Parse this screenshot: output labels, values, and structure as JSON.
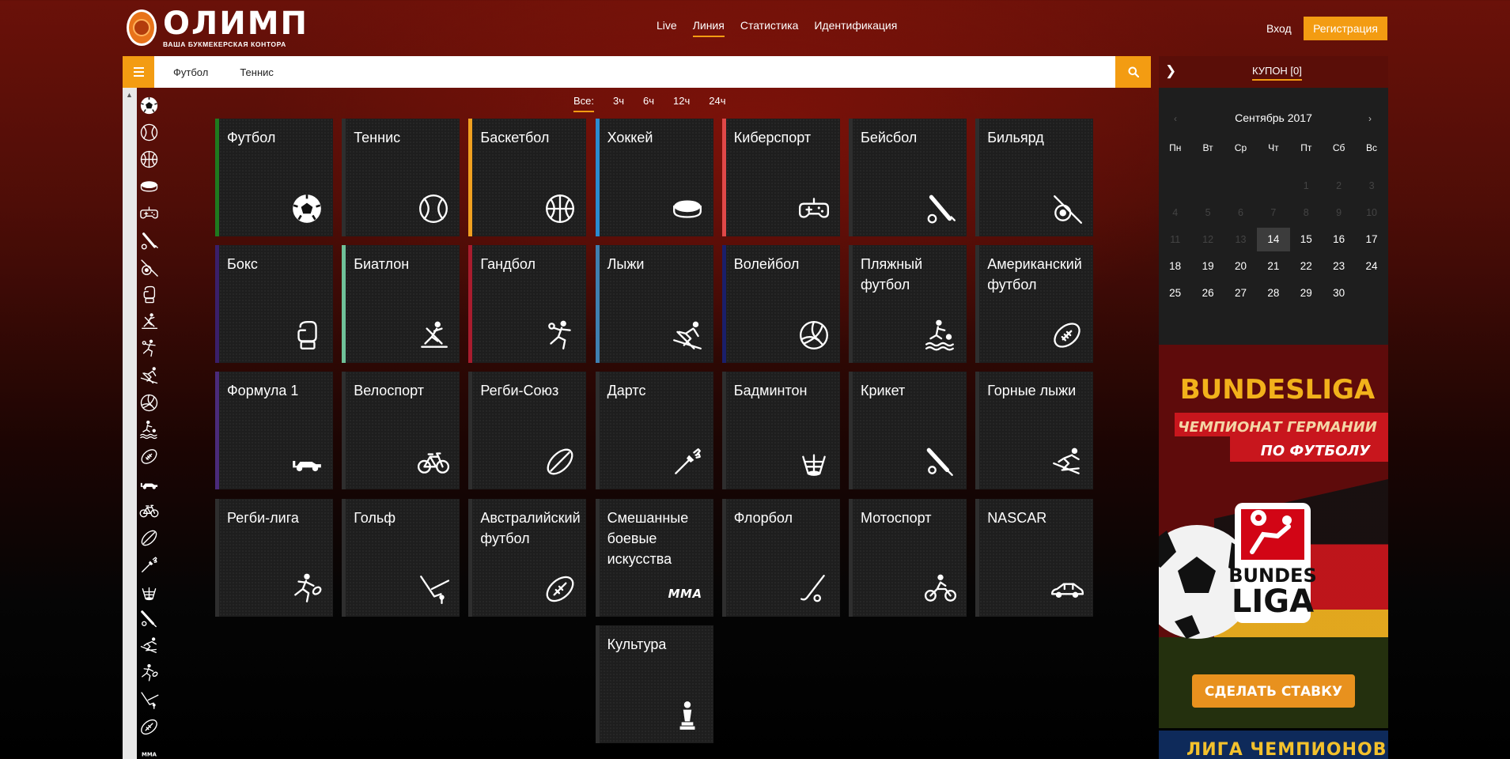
{
  "header": {
    "logo_name": "ОЛИМП",
    "logo_tagline": "ВАША БУКМЕКЕРСКАЯ КОНТОРА",
    "nav": [
      {
        "label": "Live",
        "active": false
      },
      {
        "label": "Линия",
        "active": true
      },
      {
        "label": "Статистика",
        "active": false
      },
      {
        "label": "Идентификация",
        "active": false
      }
    ],
    "login_label": "Вход",
    "register_label": "Регистрация"
  },
  "search": {
    "chips": [
      "Футбол",
      "Теннис"
    ],
    "icon": "search-icon"
  },
  "sidebar": {
    "icons": [
      "football",
      "tennis",
      "basketball",
      "hockey",
      "esports",
      "baseball",
      "billiards",
      "boxing",
      "biathlon",
      "handball",
      "skiing",
      "volleyball",
      "beach-football",
      "american-football",
      "formula1",
      "cycling",
      "rugby-union",
      "darts",
      "badminton",
      "cricket",
      "alpine-skiing",
      "rugby-league",
      "golf",
      "australian-football",
      "mma"
    ]
  },
  "filters": [
    {
      "label": "Все:",
      "active": true
    },
    {
      "label": "3ч",
      "active": false
    },
    {
      "label": "6ч",
      "active": false
    },
    {
      "label": "12ч",
      "active": false
    },
    {
      "label": "24ч",
      "active": false
    }
  ],
  "sports": [
    {
      "label": "Футбол",
      "icon": "football",
      "accent": "#1f7a1f"
    },
    {
      "label": "Теннис",
      "icon": "tennis",
      "accent": "#2e2e2e"
    },
    {
      "label": "Баскетбол",
      "icon": "basketball",
      "accent": "#f0a020"
    },
    {
      "label": "Хоккей",
      "icon": "hockey",
      "accent": "#2a8ad0"
    },
    {
      "label": "Киберспорт",
      "icon": "esports",
      "accent": "#e04848"
    },
    {
      "label": "Бейсбол",
      "icon": "baseball",
      "accent": "#2e2e2e"
    },
    {
      "label": "Бильярд",
      "icon": "billiards",
      "accent": "#2e2e2e"
    },
    {
      "label": "Бокс",
      "icon": "boxing",
      "accent": "#3a1f6a"
    },
    {
      "label": "Биатлон",
      "icon": "biathlon",
      "accent": "#6fc098"
    },
    {
      "label": "Гандбол",
      "icon": "handball",
      "accent": "#a81c2e"
    },
    {
      "label": "Лыжи",
      "icon": "skiing",
      "accent": "#3f7fb0"
    },
    {
      "label": "Волейбол",
      "icon": "volleyball",
      "accent": "#1a1f6a"
    },
    {
      "label": "Пляжный футбол",
      "icon": "beach-football",
      "accent": "#2e2e2e"
    },
    {
      "label": "Американский футбол",
      "icon": "american-football",
      "accent": "#2e2e2e"
    },
    {
      "label": "Формула 1",
      "icon": "formula1",
      "accent": "#4a2a7a"
    },
    {
      "label": "Велоспорт",
      "icon": "cycling",
      "accent": "#2e2e2e"
    },
    {
      "label": "Регби-Союз",
      "icon": "rugby-union",
      "accent": "#2e2e2e"
    },
    {
      "label": "Дартс",
      "icon": "darts",
      "accent": "#2e2e2e"
    },
    {
      "label": "Бадминтон",
      "icon": "badminton",
      "accent": "#2e2e2e"
    },
    {
      "label": "Крикет",
      "icon": "cricket",
      "accent": "#2e2e2e"
    },
    {
      "label": "Горные лыжи",
      "icon": "alpine-skiing",
      "accent": "#2e2e2e"
    },
    {
      "label": "Регби-лига",
      "icon": "rugby-league",
      "accent": "#2e2e2e"
    },
    {
      "label": "Гольф",
      "icon": "golf",
      "accent": "#2e2e2e"
    },
    {
      "label": "Австралийский футбол",
      "icon": "australian-football",
      "accent": "#2e2e2e"
    },
    {
      "label": "Смешанные боевые искусства",
      "icon": "mma",
      "icon_text": "MMA",
      "accent": "#2e2e2e"
    },
    {
      "label": "Флорбол",
      "icon": "floorball",
      "accent": "#2e2e2e"
    },
    {
      "label": "Мотоспорт",
      "icon": "motorsport",
      "accent": "#2e2e2e"
    },
    {
      "label": "NASCAR",
      "icon": "nascar",
      "accent": "#2e2e2e"
    },
    {
      "label": "Культура",
      "icon": "culture",
      "accent": "#2e2e2e"
    }
  ],
  "coupon": {
    "title": "КУПОН [0]"
  },
  "calendar": {
    "month": "Сентябрь 2017",
    "weekdays": [
      "Пн",
      "Вт",
      "Ср",
      "Чт",
      "Пт",
      "Сб",
      "Вс"
    ],
    "weeks": [
      [
        "",
        "",
        "",
        "",
        "1",
        "2",
        "3"
      ],
      [
        "4",
        "5",
        "6",
        "7",
        "8",
        "9",
        "10"
      ],
      [
        "11",
        "12",
        "13",
        "14",
        "15",
        "16",
        "17"
      ],
      [
        "18",
        "19",
        "20",
        "21",
        "22",
        "23",
        "24"
      ],
      [
        "25",
        "26",
        "27",
        "28",
        "29",
        "30",
        ""
      ]
    ],
    "today": "14",
    "first_active": 14
  },
  "banner": {
    "title": "BUNDESLIGA",
    "subtitle_1": "ЧЕМПИОНАТ ГЕРМАНИИ",
    "subtitle_2": "ПО ФУТБОЛУ",
    "logo_line_1": "BUNDES",
    "logo_line_2": "LIGA",
    "cta": "СДЕЛАТЬ СТАВКУ",
    "next_banner_text": "ЛИГА ЧЕМПИОНОВ"
  }
}
